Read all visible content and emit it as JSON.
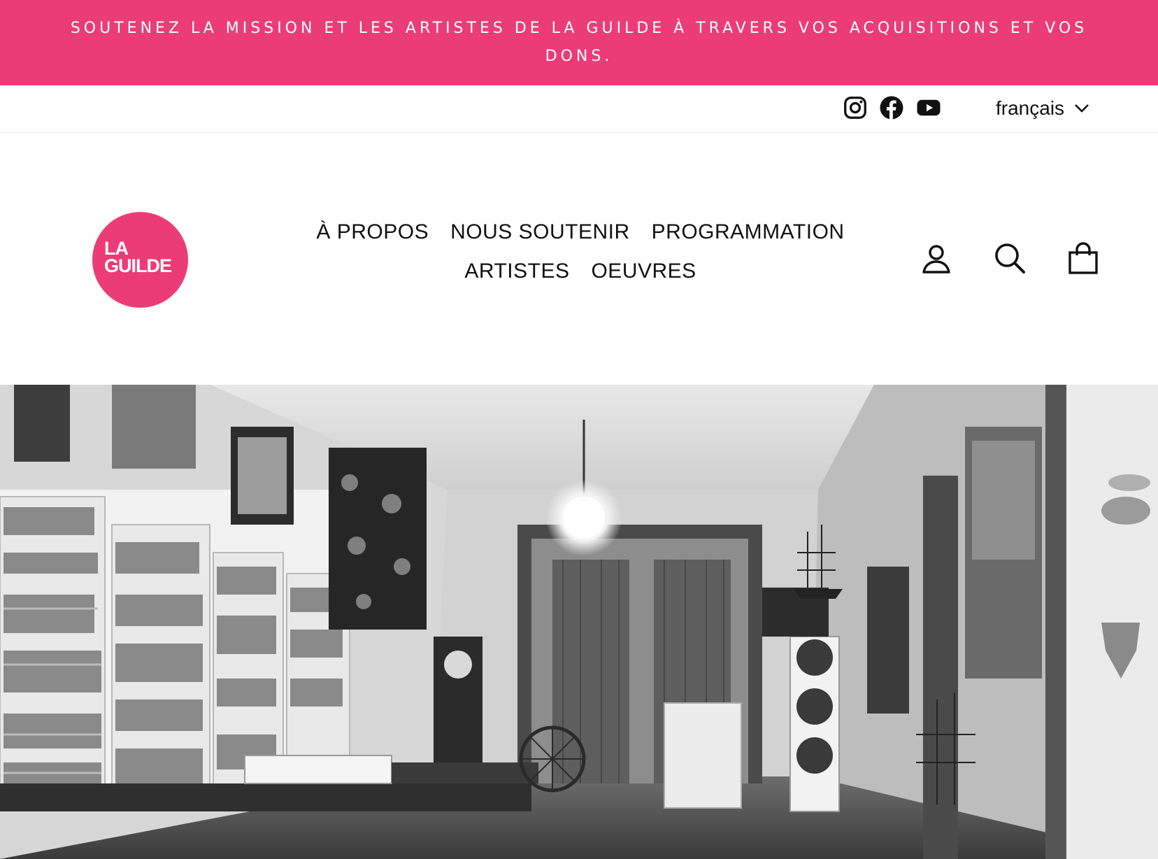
{
  "announcement": {
    "text": "SOUTENEZ LA MISSION ET LES ARTISTES DE LA GUILDE À TRAVERS VOS ACQUISITIONS ET VOS DONS."
  },
  "utility": {
    "social": [
      {
        "name": "Instagram",
        "icon": "instagram-icon"
      },
      {
        "name": "Facebook",
        "icon": "facebook-icon"
      },
      {
        "name": "YouTube",
        "icon": "youtube-icon"
      }
    ],
    "language": {
      "selected": "français",
      "icon": "chevron-down-icon"
    }
  },
  "header": {
    "logo": {
      "line1": "LA",
      "line2": "GUILDE",
      "color": "#ec3c77"
    },
    "nav": [
      {
        "label": "À PROPOS"
      },
      {
        "label": "NOUS SOUTENIR"
      },
      {
        "label": "PROGRAMMATION"
      },
      {
        "label": "ARTISTES"
      },
      {
        "label": "OEUVRES"
      }
    ],
    "icons": {
      "account": "account-icon",
      "search": "search-icon",
      "cart": "cart-icon"
    }
  },
  "hero": {
    "image": "black-and-white-archival-photo-of-craft-shop-interior"
  },
  "colors": {
    "accent": "#ec3c77",
    "text": "#111111",
    "background": "#ffffff"
  }
}
